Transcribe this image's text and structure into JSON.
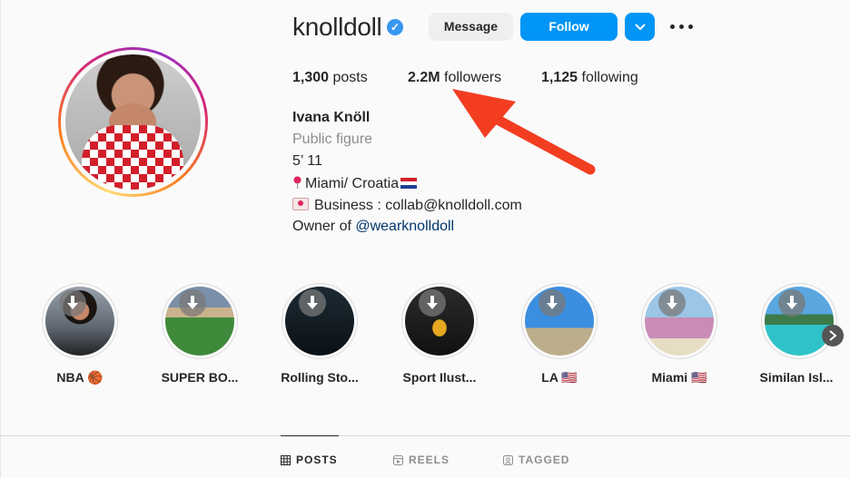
{
  "profile": {
    "username": "knolldoll",
    "verified_badge": "✓",
    "buttons": {
      "message": "Message",
      "follow": "Follow"
    },
    "stats": {
      "posts": {
        "count": "1,300",
        "label": "posts"
      },
      "followers": {
        "count": "2.2M",
        "label": "followers"
      },
      "following": {
        "count": "1,125",
        "label": "following"
      }
    },
    "bio": {
      "name": "Ivana Knöll",
      "category": "Public figure",
      "line1": "5’ 11",
      "line2": "Miami/ Croatia",
      "line3": "Business : collab@knolldoll.com",
      "line4_prefix": "Owner of ",
      "line4_link": "@wearknolldoll"
    }
  },
  "highlights": [
    {
      "label": "NBA 🏀"
    },
    {
      "label": "SUPER BO..."
    },
    {
      "label": "Rolling Sto..."
    },
    {
      "label": "Sport Ilust..."
    },
    {
      "label": "LA 🇺🇸"
    },
    {
      "label": "Miami 🇺🇸"
    },
    {
      "label": "Similan Isl..."
    }
  ],
  "tabs": {
    "posts": "POSTS",
    "reels": "REELS",
    "tagged": "TAGGED"
  },
  "annotation": {
    "arrow_color": "#f23d21"
  },
  "colors": {
    "accent": "#0095f6",
    "text": "#262626",
    "muted": "#8e8e8e",
    "link": "#00376b"
  }
}
